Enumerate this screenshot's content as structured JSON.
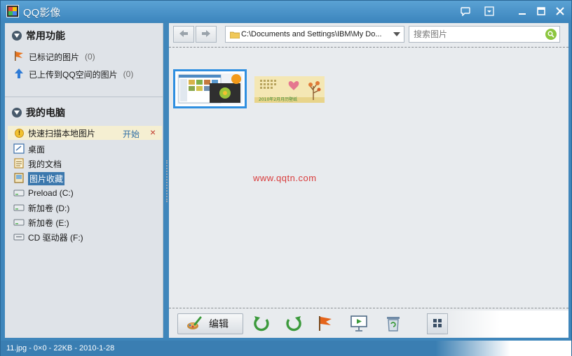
{
  "app": {
    "title": "QQ影像",
    "logo_icon": "qq-image-logo-icon"
  },
  "window_controls": {
    "feedback_icon": "speech-bubble-icon",
    "menu_icon": "menu-dropdown-icon",
    "minimize_icon": "minimize-icon",
    "maximize_icon": "maximize-icon",
    "close_icon": "close-icon"
  },
  "sidebar": {
    "common": {
      "header": "常用功能",
      "items": [
        {
          "label": "已标记的图片",
          "count": "(0)",
          "icon": "orange-flag-icon"
        },
        {
          "label": "已上传到QQ空间的图片",
          "count": "(0)",
          "icon": "upload-arrow-icon"
        }
      ]
    },
    "computer": {
      "header": "我的电脑",
      "scan": {
        "label": "快速扫描本地图片",
        "start": "开始",
        "close": "×"
      },
      "items": [
        {
          "label": "桌面",
          "icon": "desktop-icon"
        },
        {
          "label": "我的文档",
          "icon": "documents-icon"
        },
        {
          "label": "图片收藏",
          "icon": "pictures-icon",
          "selected": true
        },
        {
          "label": "Preload (C:)",
          "icon": "drive-icon"
        },
        {
          "label": "新加卷 (D:)",
          "icon": "drive-icon"
        },
        {
          "label": "新加卷 (E:)",
          "icon": "drive-icon"
        },
        {
          "label": "CD 驱动器 (F:)",
          "icon": "cd-drive-icon"
        }
      ]
    }
  },
  "toolbar": {
    "back_icon": "back-arrow-icon",
    "forward_icon": "forward-arrow-icon",
    "address": "C:\\Documents and Settings\\IBM\\My Do...",
    "search_placeholder": "搜索图片"
  },
  "gallery": {
    "watermark": "www.qqtn.com",
    "thumbnails": [
      {
        "name": "11.jpg",
        "selected": true
      },
      {
        "name": "calendar",
        "text": "2010年2月月历壁纸"
      }
    ]
  },
  "bottom_toolbar": {
    "edit_label": "编辑",
    "tools": [
      "rotate-left-icon",
      "rotate-right-icon",
      "flag-icon",
      "slideshow-icon",
      "delete-icon",
      "grid-view-icon"
    ]
  },
  "status": {
    "text": "11.jpg - 0×0 - 22KB - 2010-1-28"
  },
  "colors": {
    "frame": "#3f86bb",
    "sidebar_bg": "#dfe3e8",
    "main_bg": "#e8ebee",
    "selection": "#2f8fe0",
    "watermark": "#d93c3c"
  }
}
